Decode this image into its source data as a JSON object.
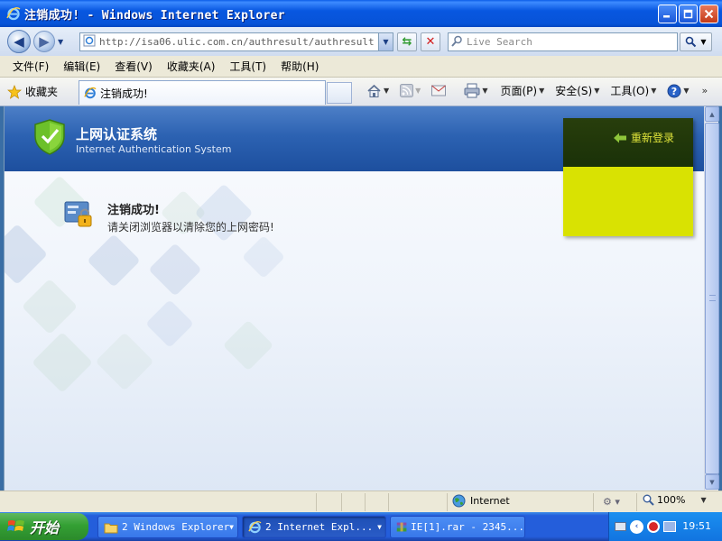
{
  "window": {
    "title": "注销成功! - Windows Internet Explorer"
  },
  "address_bar": {
    "url": "http://isa06.ulic.com.cn/authresult/authresult.htm?"
  },
  "search": {
    "placeholder": "Live Search"
  },
  "menu": [
    "文件(F)",
    "编辑(E)",
    "查看(V)",
    "收藏夹(A)",
    "工具(T)",
    "帮助(H)"
  ],
  "command_bar": {
    "favorites_label": "收藏夹",
    "tab_title": "注销成功!",
    "page_label": "页面(P)",
    "safety_label": "安全(S)",
    "tools_label": "工具(O)"
  },
  "page": {
    "system_title": "上网认证系统",
    "system_subtitle": "Internet Authentication System",
    "relogin_label": "重新登录",
    "message_title": "注销成功!",
    "message_body": "请关闭浏览器以清除您的上网密码!"
  },
  "status_bar": {
    "zone": "Internet",
    "zoom": "100%"
  },
  "taskbar": {
    "start_label": "开始",
    "buttons": [
      {
        "label": "2 Windows Explorer"
      },
      {
        "label": "2 Internet Expl..."
      },
      {
        "label": "IE[1].rar - 2345..."
      }
    ],
    "clock": "19:51"
  },
  "colors": {
    "banner": "#2c62b2",
    "relogin_box": "#d9e202",
    "relogin_text": "#e0e43b",
    "xp_taskbar": "#245edb",
    "start_button": "#34a034"
  },
  "icons": [
    "ie-logo-icon",
    "back-icon",
    "forward-icon",
    "refresh-icon",
    "stop-icon",
    "search-icon",
    "star-icon",
    "home-icon",
    "rss-icon",
    "mail-icon",
    "print-icon",
    "help-icon",
    "shield-icon",
    "lock-card-icon",
    "arrow-left-icon",
    "globe-icon",
    "zoom-icon",
    "folder-icon",
    "winrar-icon"
  ]
}
